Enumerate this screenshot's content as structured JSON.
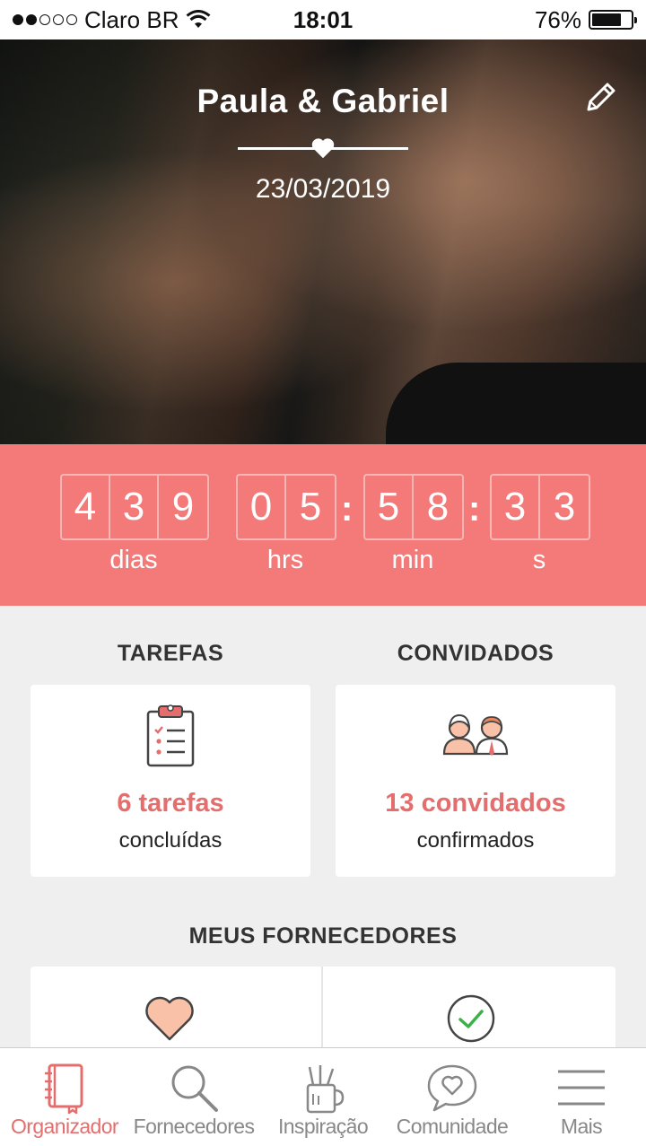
{
  "status_bar": {
    "carrier": "Claro BR",
    "time": "18:01",
    "battery": "76%",
    "battery_level": 0.76,
    "signal_bars_filled": 2,
    "signal_bars_total": 5
  },
  "hero": {
    "couple_names": "Paula & Gabriel",
    "wedding_date": "23/03/2019"
  },
  "countdown": {
    "days_digits": [
      "4",
      "3",
      "9"
    ],
    "hours_digits": [
      "0",
      "5"
    ],
    "minutes_digits": [
      "5",
      "8"
    ],
    "seconds_digits": [
      "3",
      "3"
    ],
    "separator": ":",
    "labels": {
      "days": "dias",
      "hours": "hrs",
      "minutes": "min",
      "seconds": "s"
    }
  },
  "tasks": {
    "title": "TAREFAS",
    "count": "6 tarefas",
    "subtitle": "concluídas"
  },
  "guests": {
    "title": "CONVIDADOS",
    "count": "13 convidados",
    "subtitle": "confirmados"
  },
  "vendors": {
    "title": "MEUS FORNECEDORES"
  },
  "tab_bar": {
    "items": [
      {
        "label": "Organizador",
        "icon": "notebook-icon",
        "active": true
      },
      {
        "label": "Fornecedores",
        "icon": "search-icon",
        "active": false
      },
      {
        "label": "Inspiração",
        "icon": "pencil-cup-icon",
        "active": false
      },
      {
        "label": "Comunidade",
        "icon": "chat-heart-icon",
        "active": false
      },
      {
        "label": "Mais",
        "icon": "menu-icon",
        "active": false
      }
    ]
  },
  "colors": {
    "accent": "#e36e6d",
    "countdown_bg": "#f37a78",
    "background": "#efefef",
    "success": "#3cb04a",
    "heart_fill": "#f9c2a8"
  }
}
